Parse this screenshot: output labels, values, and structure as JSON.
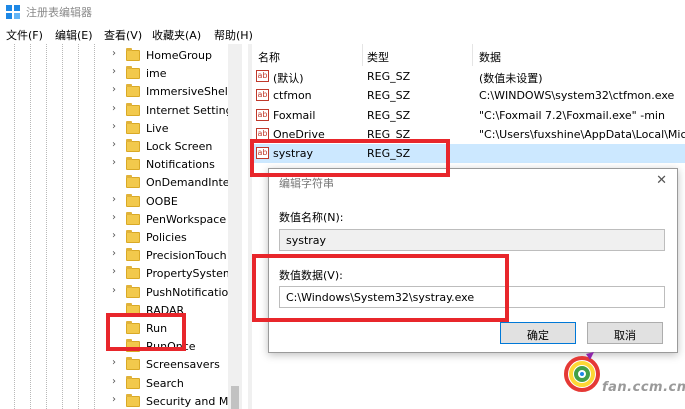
{
  "window": {
    "title": "注册表编辑器"
  },
  "menu": [
    "文件(F)",
    "编辑(E)",
    "查看(V)",
    "收藏夹(A)",
    "帮助(H)"
  ],
  "tree": {
    "items": [
      {
        "label": "HomeGroup",
        "expander": "›"
      },
      {
        "label": "ime",
        "expander": "›"
      },
      {
        "label": "ImmersiveShell",
        "expander": "›"
      },
      {
        "label": "Internet Setting",
        "expander": "›"
      },
      {
        "label": "Live",
        "expander": "›"
      },
      {
        "label": "Lock Screen",
        "expander": "›"
      },
      {
        "label": "Notifications",
        "expander": "›"
      },
      {
        "label": "OnDemandInte",
        "expander": ""
      },
      {
        "label": "OOBE",
        "expander": "›"
      },
      {
        "label": "PenWorkspace",
        "expander": "›"
      },
      {
        "label": "Policies",
        "expander": "›"
      },
      {
        "label": "PrecisionTouch",
        "expander": "›"
      },
      {
        "label": "PropertySystem",
        "expander": "›"
      },
      {
        "label": "PushNotification",
        "expander": "›"
      },
      {
        "label": "RADAR",
        "expander": ""
      },
      {
        "label": "Run",
        "expander": ""
      },
      {
        "label": "RunOnce",
        "expander": ""
      },
      {
        "label": "Screensavers",
        "expander": "›"
      },
      {
        "label": "Search",
        "expander": "›"
      },
      {
        "label": "Security and Ma",
        "expander": "›"
      }
    ]
  },
  "values_pane": {
    "headers": {
      "name": "名称",
      "type": "类型",
      "data": "数据"
    },
    "rows": [
      {
        "name": "(默认)",
        "type": "REG_SZ",
        "data": "(数值未设置)"
      },
      {
        "name": "ctfmon",
        "type": "REG_SZ",
        "data": "C:\\WINDOWS\\system32\\ctfmon.exe"
      },
      {
        "name": "Foxmail",
        "type": "REG_SZ",
        "data": "\"C:\\Foxmail 7.2\\Foxmail.exe\" -min"
      },
      {
        "name": "OneDrive",
        "type": "REG_SZ",
        "data": "\"C:\\Users\\fuxshine\\AppData\\Local\\Micr"
      },
      {
        "name": "systray",
        "type": "REG_SZ",
        "data": ""
      }
    ],
    "icon_glyph": "ab"
  },
  "dialog": {
    "title": "编辑字符串",
    "close_glyph": "✕",
    "name_label": "数值名称(N):",
    "name_value": "systray",
    "data_label": "数值数据(V):",
    "data_value": "C:\\Windows\\System32\\systray.exe",
    "ok_label": "确定",
    "cancel_label": "取消"
  },
  "watermark": {
    "text": "fan.ccm.cn"
  },
  "colors": {
    "highlight_border": "#e8262b",
    "selected_row": "#cce8ff",
    "folder": "#f2c94c"
  }
}
